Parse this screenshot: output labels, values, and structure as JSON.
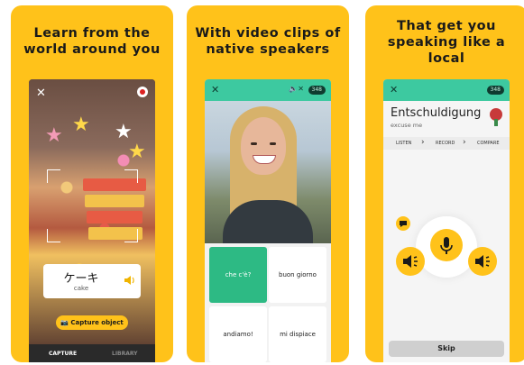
{
  "panels": [
    {
      "headline_line1": "Learn from the",
      "headline_line2": "world around you",
      "card_word": "ケーキ",
      "card_translation": "cake",
      "capture_button": "Capture object",
      "tabs": [
        "CAPTURE",
        "LIBRARY"
      ]
    },
    {
      "headline_line1": "With video clips of",
      "headline_line2": "native speakers",
      "badge": "348",
      "options": [
        "che c'è?",
        "buon giorno",
        "andiamo!",
        "mi dispiace"
      ],
      "selected_option": 0
    },
    {
      "headline_line1": "That get you",
      "headline_line2": "speaking like a",
      "headline_line3": "local",
      "badge": "348",
      "word": "Entschuldigung",
      "translation": "excuse me",
      "steps": [
        "LISTEN",
        "RECORD",
        "COMPARE"
      ],
      "skip_button": "Skip"
    }
  ],
  "colors": {
    "panel_bg": "#ffc21a",
    "accent_green": "#3dc9a0",
    "selected_option": "#2dba84"
  },
  "icons": [
    "close-icon",
    "record-icon",
    "speaker-icon",
    "camera-icon",
    "mute-icon",
    "chevron-right-icon",
    "microphone-icon",
    "speech-bubble-icon",
    "rose-icon"
  ]
}
